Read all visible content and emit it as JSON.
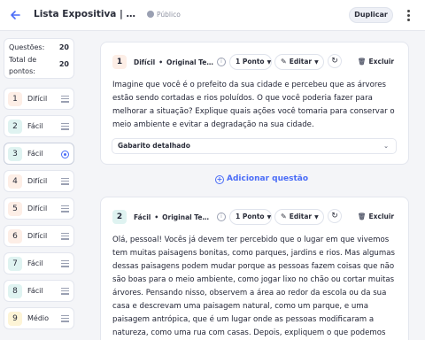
{
  "header": {
    "title": "Lista Expositiva | Conserva...",
    "visibility": "Público",
    "duplicate_label": "Duplicar"
  },
  "sidebar": {
    "questions_label": "Questões:",
    "questions_count": "20",
    "total_label": "Total de pontos:",
    "total_points": "20",
    "items": [
      {
        "num": "1",
        "label": "Difícil",
        "color": "#fdeee6"
      },
      {
        "num": "2",
        "label": "Fácil",
        "color": "#dff3f1"
      },
      {
        "num": "3",
        "label": "Fácil",
        "color": "#dff3f1",
        "active": true
      },
      {
        "num": "4",
        "label": "Difícil",
        "color": "#fdeee6"
      },
      {
        "num": "5",
        "label": "Difícil",
        "color": "#fdeee6"
      },
      {
        "num": "6",
        "label": "Difícil",
        "color": "#fdeee6"
      },
      {
        "num": "7",
        "label": "Fácil",
        "color": "#dff3f1"
      },
      {
        "num": "8",
        "label": "Fácil",
        "color": "#dff3f1"
      },
      {
        "num": "9",
        "label": "Médio",
        "color": "#fdf4d6"
      }
    ]
  },
  "questions": [
    {
      "num": "1",
      "difficulty": "Difícil",
      "origin": "Original Teac...",
      "points": "1 Ponto",
      "edit_label": "Editar",
      "delete_label": "Excluir",
      "badge_color": "#fdeee6",
      "text": "Imagine que você é o prefeito da sua cidade e percebeu que as árvores estão sendo cortadas e rios poluídos. O que você poderia fazer para melhorar a situação? Explique quais ações você tomaria para conservar o meio ambiente e evitar a degradação na sua cidade.",
      "answer_label": "Gabarito detalhado"
    },
    {
      "num": "2",
      "difficulty": "Fácil",
      "origin": "Original Teac...",
      "points": "1 Ponto",
      "edit_label": "Editar",
      "delete_label": "Excluir",
      "badge_color": "#dff3f1",
      "text": "Olá, pessoal! Vocês já devem ter percebido que o lugar em que vivemos tem muitas paisagens bonitas, como parques, jardins e rios. Mas algumas dessas paisagens podem mudar porque as pessoas fazem coisas que não são boas para o meio ambiente, como jogar lixo no chão ou cortar muitas árvores. Pensando nisso, observem a área ao redor da escola ou da sua casa e descrevam uma paisagem natural, como um parque, e uma paisagem antrópica, que é um lugar onde as pessoas modificaram a natureza, como uma rua com casas. Depois, expliquem o que podemos fazer para ajudar a conservar"
    }
  ],
  "add_question_label": "Adicionar questão"
}
